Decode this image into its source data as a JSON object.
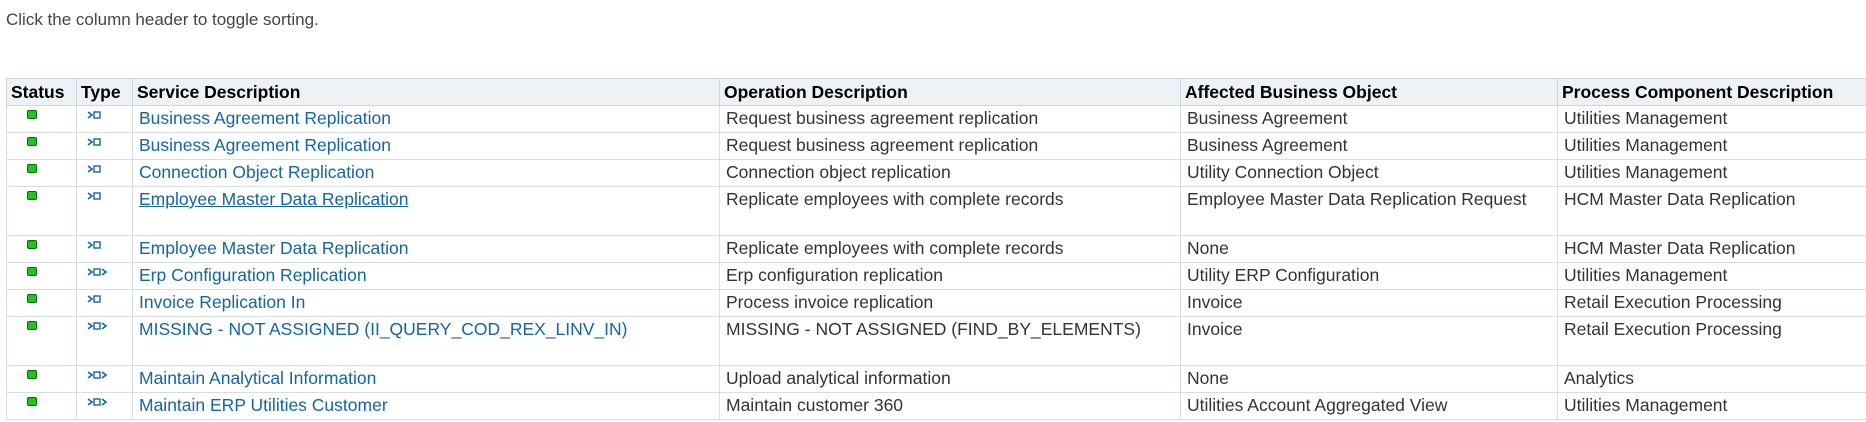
{
  "hint_text": "Click the column header to toggle sorting.",
  "columns": {
    "status": "Status",
    "type": "Type",
    "service": "Service Description",
    "operation": "Operation Description",
    "business_object": "Affected Business Object",
    "process_component": "Process Component Description"
  },
  "colors": {
    "link": "#1464a8",
    "status_ok": "#22c222",
    "header_bg": "#eef1f5"
  },
  "rows": [
    {
      "status": "ok",
      "type_icon": "inbound-service-icon",
      "service": "Business Agreement Replication",
      "operation": "Request business agreement replication",
      "business_object": "Business Agreement",
      "process_component": "Utilities Management"
    },
    {
      "status": "ok",
      "type_icon": "inbound-service-icon",
      "service": "Business Agreement Replication",
      "operation": "Request business agreement replication",
      "business_object": "Business Agreement",
      "process_component": "Utilities Management"
    },
    {
      "status": "ok",
      "type_icon": "inbound-service-icon",
      "service": "Connection Object Replication",
      "operation": "Connection object replication",
      "business_object": "Utility Connection Object",
      "process_component": "Utilities Management"
    },
    {
      "status": "ok",
      "type_icon": "inbound-service-icon",
      "service": "Employee Master Data Replication",
      "operation": "Replicate employees with complete records",
      "business_object": "Employee Master Data Replication Request",
      "process_component": "HCM Master Data Replication"
    },
    {
      "status": "ok",
      "type_icon": "inbound-service-icon",
      "service": "Employee Master Data Replication",
      "operation": "Replicate employees with complete records",
      "business_object": "None",
      "process_component": "HCM Master Data Replication"
    },
    {
      "status": "ok",
      "type_icon": "inbound-outbound-service-icon",
      "service": "Erp Configuration Replication",
      "operation": "Erp configuration replication",
      "business_object": "Utility ERP Configuration",
      "process_component": "Utilities Management"
    },
    {
      "status": "ok",
      "type_icon": "inbound-service-icon",
      "service": "Invoice Replication In",
      "operation": "Process invoice replication",
      "business_object": "Invoice",
      "process_component": "Retail Execution Processing"
    },
    {
      "status": "ok",
      "type_icon": "inbound-outbound-service-icon",
      "service": "MISSING - NOT ASSIGNED (II_QUERY_COD_REX_LINV_IN)",
      "operation": "MISSING - NOT ASSIGNED (FIND_BY_ELEMENTS)",
      "business_object": "Invoice",
      "process_component": "Retail Execution Processing"
    },
    {
      "status": "ok",
      "type_icon": "inbound-outbound-service-icon",
      "service": "Maintain Analytical Information",
      "operation": "Upload analytical information",
      "business_object": "None",
      "process_component": "Analytics"
    },
    {
      "status": "ok",
      "type_icon": "inbound-outbound-service-icon",
      "service": "Maintain ERP Utilities Customer",
      "operation": "Maintain customer 360",
      "business_object": "Utilities Account Aggregated View",
      "process_component": "Utilities Management"
    }
  ]
}
